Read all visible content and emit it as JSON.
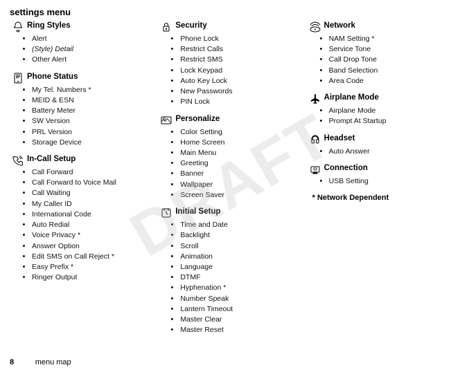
{
  "page": {
    "title": "settings menu",
    "footer_page": "8",
    "footer_label": "menu map",
    "network_note": "* Network Dependent",
    "draft_text": "DRAFT"
  },
  "columns": [
    {
      "id": "col1",
      "sections": [
        {
          "id": "ring-styles",
          "icon": "ring-icon",
          "title": "Ring Styles",
          "items": [
            "Alert",
            "(Style) Detail",
            "Other Alert"
          ]
        },
        {
          "id": "phone-status",
          "icon": "phone-status-icon",
          "title": "Phone Status",
          "items": [
            "My Tel. Numbers *",
            "MEID & ESN",
            "Battery Meter",
            "SW Version",
            "PRL Version",
            "Storage Device"
          ]
        },
        {
          "id": "in-call-setup",
          "icon": "in-call-icon",
          "title": "In-Call Setup",
          "items": [
            "Call Forward",
            "Call Forward to Voice Mail",
            "Call Waiting",
            "My Caller ID",
            "International Code",
            "Auto Redial",
            "Voice Privacy *",
            "Answer Option",
            "Edit SMS on Call Reject *",
            "Easy Prefix *",
            "Ringer Output"
          ]
        }
      ]
    },
    {
      "id": "col2",
      "sections": [
        {
          "id": "security",
          "icon": "security-icon",
          "title": "Security",
          "items": [
            "Phone Lock",
            "Restrict Calls",
            "Restrict SMS",
            "Lock Keypad",
            "Auto Key Lock",
            "New Passwords",
            "PIN Lock"
          ]
        },
        {
          "id": "personalize",
          "icon": "personalize-icon",
          "title": "Personalize",
          "items": [
            "Color Setting",
            "Home Screen",
            "Main Menu",
            "Greeting",
            "Banner",
            "Wallpaper",
            "Screen Saver"
          ]
        },
        {
          "id": "initial-setup",
          "icon": "initial-setup-icon",
          "title": "Initial Setup",
          "items": [
            "Time and Date",
            "Backlight",
            "Scroll",
            "Animation",
            "Language",
            "DTMF",
            "Hyphenation *",
            "Number Speak",
            "Lantern Timeout",
            "Master Clear",
            "Master Reset"
          ]
        }
      ]
    },
    {
      "id": "col3",
      "sections": [
        {
          "id": "network",
          "icon": "network-icon",
          "title": "Network",
          "items": [
            "NAM Setting *",
            "Service Tone",
            "Call Drop Tone",
            "Band Selection",
            "Area Code"
          ]
        },
        {
          "id": "airplane-mode",
          "icon": "airplane-icon",
          "title": "Airplane Mode",
          "items": [
            "Airplane Mode",
            "Prompt At Startup"
          ]
        },
        {
          "id": "headset",
          "icon": "headset-icon",
          "title": "Headset",
          "items": [
            "Auto Answer"
          ]
        },
        {
          "id": "connection",
          "icon": "connection-icon",
          "title": "Connection",
          "items": [
            "USB Setting"
          ]
        }
      ]
    }
  ]
}
